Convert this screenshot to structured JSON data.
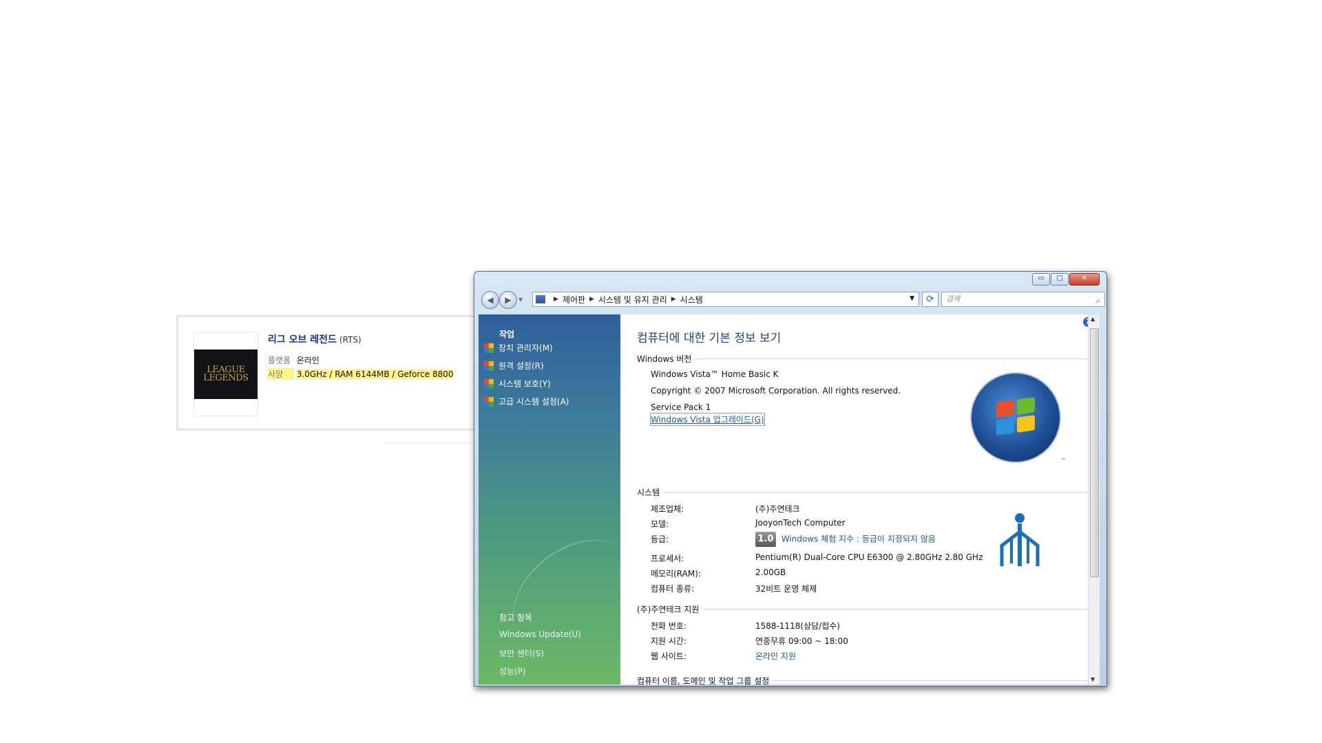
{
  "game_card": {
    "title": "리그 오브 레전드",
    "genre": "(RTS)",
    "thumbnail_text": "LEAGUE LEGENDS",
    "platform_label": "플랫폼",
    "platform_value": "온라인",
    "spec_label": "사양",
    "spec_value": "3.0GHz / RAM 6144MB / Geforce 8800"
  },
  "window": {
    "caption": {
      "minimize": "▭",
      "maximize": "□",
      "close": "✕"
    },
    "address": {
      "crumbs": [
        "제어판",
        "시스템 및 유지 관리",
        "시스템"
      ]
    },
    "search": {
      "placeholder": "검색"
    },
    "sidebar": {
      "tasks_title": "작업",
      "tasks": [
        "장치 관리자(M)",
        "원격 설정(R)",
        "시스템 보호(Y)",
        "고급 시스템 설정(A)"
      ],
      "see_also_title": "참고 항목",
      "see_also": [
        "Windows Update(U)",
        "보안 센터(S)",
        "성능(P)"
      ]
    },
    "content": {
      "page_title": "컴퓨터에 대한 기본 정보 보기",
      "edition": {
        "heading": "Windows 버전",
        "name": "Windows Vista™ Home Basic K",
        "copyright": "Copyright © 2007 Microsoft Corporation.  All rights reserved.",
        "service_pack": "Service Pack 1",
        "upgrade_link": "Windows Vista 업그레이드(G)"
      },
      "system": {
        "heading": "시스템",
        "rows": [
          {
            "label": "제조업체:",
            "value": "(주)주연테크"
          },
          {
            "label": "모델:",
            "value": "JooyonTech Computer"
          },
          {
            "label": "등급:",
            "value": "Windows 체험 지수 : 등급이 지정되지 않음"
          },
          {
            "label": "프로세서:",
            "value": "Pentium(R) Dual-Core  CPU      E6300  @ 2.80GHz   2.80 GHz"
          },
          {
            "label": "메모리(RAM):",
            "value": "2.00GB"
          },
          {
            "label": "컴퓨터 종류:",
            "value": "32비트 운영 체제"
          }
        ],
        "rating_badge": "1.0"
      },
      "support": {
        "heading": "(주)주연테크 지원",
        "rows": [
          {
            "label": "전화 번호:",
            "value": "1588-1118(상담/접수)"
          },
          {
            "label": "지원 시간:",
            "value": "연중무휴 09:00 ~ 18:00"
          },
          {
            "label": "웹 사이트:",
            "value": "온라인 지원"
          }
        ]
      },
      "next_section": "컴퓨터 이름, 도메인 및 작업 그룹 설정",
      "logo_tm": "™"
    }
  },
  "colors": {
    "link": "#1a55b8",
    "title": "#1e3f8c",
    "highlight": "#fff58a"
  }
}
